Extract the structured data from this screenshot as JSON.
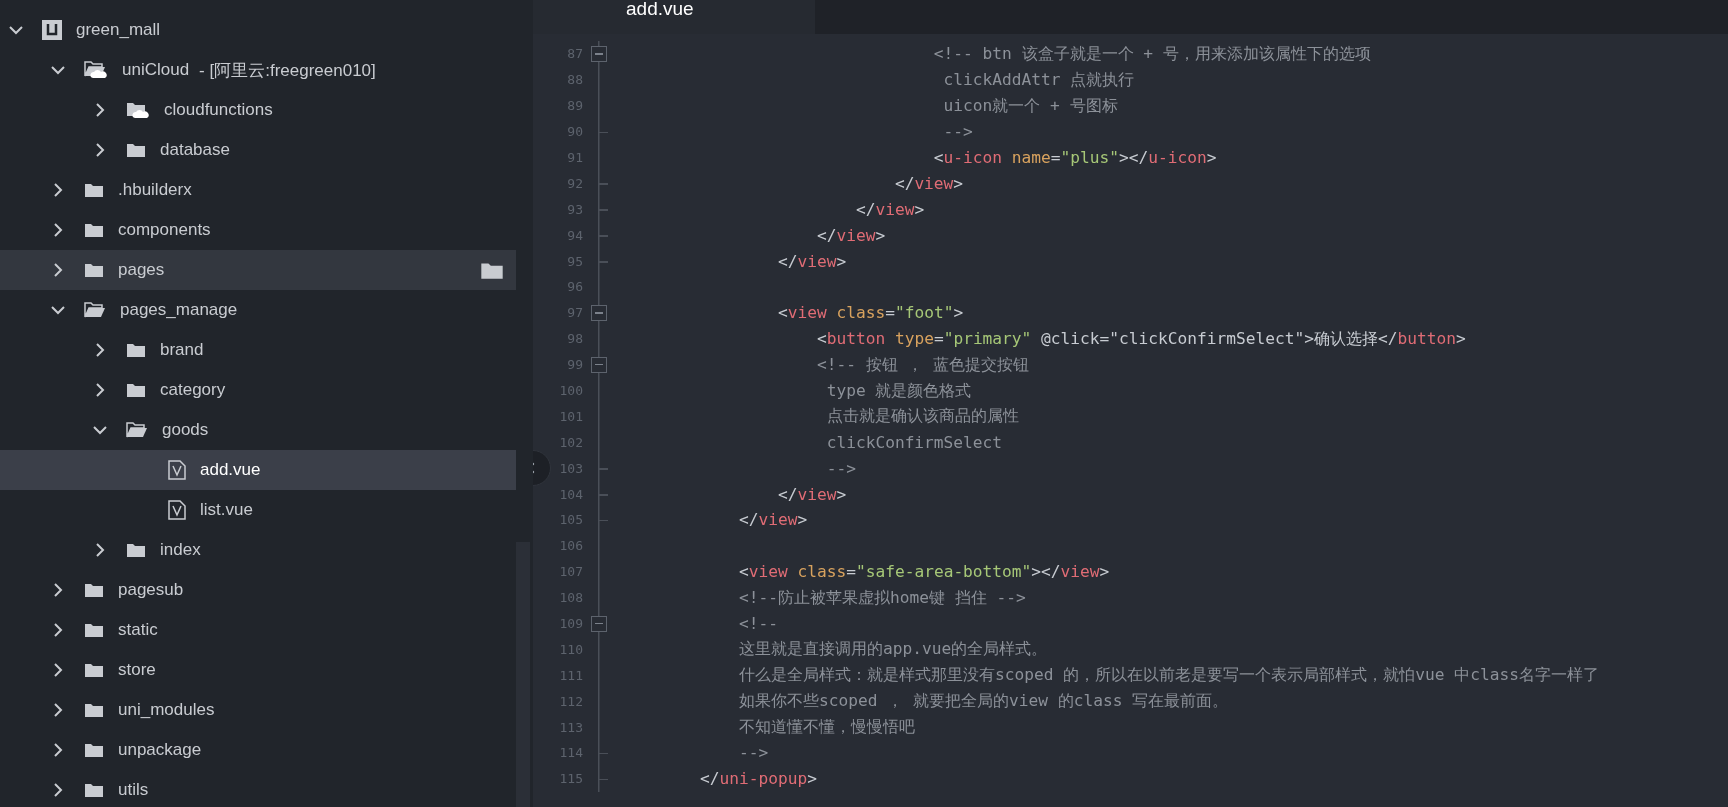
{
  "sidebar": {
    "tree": [
      {
        "label": "green_mall",
        "kind": "project",
        "expanded": true,
        "selected": false,
        "hovered": false,
        "children": [
          {
            "label": "uniCloud",
            "note": "- [阿里云:freegreen010]",
            "kind": "cloud",
            "expanded": true,
            "selected": false,
            "hovered": false,
            "children": [
              {
                "label": "cloudfunctions",
                "kind": "cloud",
                "expanded": false,
                "selected": false,
                "hovered": false
              },
              {
                "label": "database",
                "kind": "folder",
                "expanded": false,
                "selected": false,
                "hovered": false
              }
            ]
          },
          {
            "label": ".hbuilderx",
            "kind": "folder",
            "expanded": false,
            "selected": false,
            "hovered": false
          },
          {
            "label": "components",
            "kind": "folder",
            "expanded": false,
            "selected": false,
            "hovered": false
          },
          {
            "label": "pages",
            "kind": "folder",
            "expanded": false,
            "selected": false,
            "hovered": true
          },
          {
            "label": "pages_manage",
            "kind": "folder",
            "expanded": true,
            "selected": false,
            "hovered": false,
            "children": [
              {
                "label": "brand",
                "kind": "folder",
                "expanded": false,
                "selected": false,
                "hovered": false
              },
              {
                "label": "category",
                "kind": "folder",
                "expanded": false,
                "selected": false,
                "hovered": false
              },
              {
                "label": "goods",
                "kind": "folder",
                "expanded": true,
                "selected": false,
                "hovered": false,
                "children": [
                  {
                    "label": "add.vue",
                    "kind": "file",
                    "selected": true,
                    "hovered": false
                  },
                  {
                    "label": "list.vue",
                    "kind": "file",
                    "selected": false,
                    "hovered": false
                  }
                ]
              },
              {
                "label": "index",
                "kind": "folder",
                "expanded": false,
                "selected": false,
                "hovered": false
              }
            ]
          },
          {
            "label": "pagesub",
            "kind": "folder",
            "expanded": false,
            "selected": false,
            "hovered": false
          },
          {
            "label": "static",
            "kind": "folder",
            "expanded": false,
            "selected": false,
            "hovered": false
          },
          {
            "label": "store",
            "kind": "folder",
            "expanded": false,
            "selected": false,
            "hovered": false
          },
          {
            "label": "uni_modules",
            "kind": "folder",
            "expanded": false,
            "selected": false,
            "hovered": false
          },
          {
            "label": "unpackage",
            "kind": "folder",
            "expanded": false,
            "selected": false,
            "hovered": false
          },
          {
            "label": "utils",
            "kind": "folder",
            "expanded": false,
            "selected": false,
            "hovered": false
          }
        ]
      }
    ]
  },
  "editor": {
    "tabs": [
      {
        "label": "add.vue",
        "selected": true
      }
    ],
    "lines": [
      {
        "number": "87",
        "kind": "opener",
        "tokens": [
          {
            "kind": "comment",
            "text": "                                <!-- btn 该盒子就是一个 + 号，用来添加该属性下的选项"
          }
        ]
      },
      {
        "number": "88",
        "kind": "plain",
        "tokens": [
          {
            "kind": "comment",
            "text": "                                 clickAddAttr 点就执行"
          }
        ]
      },
      {
        "number": "89",
        "kind": "plain",
        "tokens": [
          {
            "kind": "comment",
            "text": "                                 uicon就一个 + 号图标"
          }
        ]
      },
      {
        "number": "90",
        "kind": "closer",
        "tokens": [
          {
            "kind": "comment",
            "text": "                                 -->"
          }
        ]
      },
      {
        "number": "91",
        "kind": "plain",
        "tokens": [
          {
            "kind": "punct",
            "text": "                                <"
          },
          {
            "kind": "tag",
            "text": "u-icon"
          },
          {
            "kind": "attr",
            "text": " name"
          },
          {
            "kind": "punct",
            "text": "="
          },
          {
            "kind": "string",
            "text": "\"plus\""
          },
          {
            "kind": "punct",
            "text": "></"
          },
          {
            "kind": "tag",
            "text": "u-icon"
          },
          {
            "kind": "punct",
            "text": ">"
          }
        ]
      },
      {
        "number": "92",
        "kind": "closer",
        "tokens": [
          {
            "kind": "punct",
            "text": "                            </"
          },
          {
            "kind": "tag",
            "text": "view"
          },
          {
            "kind": "punct",
            "text": ">"
          }
        ]
      },
      {
        "number": "93",
        "kind": "closer",
        "tokens": [
          {
            "kind": "punct",
            "text": "                        </"
          },
          {
            "kind": "tag",
            "text": "view"
          },
          {
            "kind": "punct",
            "text": ">"
          }
        ]
      },
      {
        "number": "94",
        "kind": "closer",
        "tokens": [
          {
            "kind": "punct",
            "text": "                    </"
          },
          {
            "kind": "tag",
            "text": "view"
          },
          {
            "kind": "punct",
            "text": ">"
          }
        ]
      },
      {
        "number": "95",
        "kind": "closer",
        "tokens": [
          {
            "kind": "punct",
            "text": "                </"
          },
          {
            "kind": "tag",
            "text": "view"
          },
          {
            "kind": "punct",
            "text": ">"
          }
        ]
      },
      {
        "number": "96",
        "kind": "plain"
      },
      {
        "number": "97",
        "kind": "opener",
        "tokens": [
          {
            "kind": "punct",
            "text": "                <"
          },
          {
            "kind": "tag",
            "text": "view"
          },
          {
            "kind": "attr",
            "text": " class"
          },
          {
            "kind": "punct",
            "text": "="
          },
          {
            "kind": "string",
            "text": "\"foot\""
          },
          {
            "kind": "punct",
            "text": ">"
          }
        ]
      },
      {
        "number": "98",
        "kind": "plain",
        "tokens": [
          {
            "kind": "punct",
            "text": "                    <"
          },
          {
            "kind": "tag",
            "text": "button"
          },
          {
            "kind": "attr",
            "text": " type"
          },
          {
            "kind": "punct",
            "text": "="
          },
          {
            "kind": "string",
            "text": "\"primary\""
          },
          {
            "kind": "punct",
            "text": " @click=\"clickConfirmSelect\">确认选择</"
          },
          {
            "kind": "tag",
            "text": "button"
          },
          {
            "kind": "punct",
            "text": ">"
          }
        ]
      },
      {
        "number": "99",
        "kind": "opener",
        "tokens": [
          {
            "kind": "comment",
            "text": "                    <!-- 按钮 ， 蓝色提交按钮"
          }
        ]
      },
      {
        "number": "100",
        "kind": "plain",
        "tokens": [
          {
            "kind": "comment",
            "text": "                     type 就是颜色格式"
          }
        ]
      },
      {
        "number": "101",
        "kind": "plain",
        "tokens": [
          {
            "kind": "comment",
            "text": "                     点击就是确认该商品的属性"
          }
        ]
      },
      {
        "number": "102",
        "kind": "plain",
        "tokens": [
          {
            "kind": "comment",
            "text": "                     clickConfirmSelect"
          }
        ]
      },
      {
        "number": "103",
        "kind": "closer",
        "tokens": [
          {
            "kind": "comment",
            "text": "                     -->"
          }
        ]
      },
      {
        "number": "104",
        "kind": "closer",
        "tokens": [
          {
            "kind": "punct",
            "text": "                </"
          },
          {
            "kind": "tag",
            "text": "view"
          },
          {
            "kind": "punct",
            "text": ">"
          }
        ]
      },
      {
        "number": "105",
        "kind": "closer",
        "tokens": [
          {
            "kind": "punct",
            "text": "            </"
          },
          {
            "kind": "tag",
            "text": "view"
          },
          {
            "kind": "punct",
            "text": ">"
          }
        ]
      },
      {
        "number": "106",
        "kind": "plain"
      },
      {
        "number": "107",
        "kind": "plain",
        "tokens": [
          {
            "kind": "punct",
            "text": "            <"
          },
          {
            "kind": "tag",
            "text": "view"
          },
          {
            "kind": "attr",
            "text": " class"
          },
          {
            "kind": "punct",
            "text": "="
          },
          {
            "kind": "string",
            "text": "\"safe-area-bottom\""
          },
          {
            "kind": "punct",
            "text": "></"
          },
          {
            "kind": "tag",
            "text": "view"
          },
          {
            "kind": "punct",
            "text": ">"
          }
        ]
      },
      {
        "number": "108",
        "kind": "plain",
        "tokens": [
          {
            "kind": "comment",
            "text": "            <!--防止被苹果虚拟home键 挡住 -->"
          }
        ]
      },
      {
        "number": "109",
        "kind": "opener",
        "tokens": [
          {
            "kind": "comment",
            "text": "            <!--"
          }
        ]
      },
      {
        "number": "110",
        "kind": "plain",
        "tokens": [
          {
            "kind": "comment",
            "text": "            这里就是直接调用的app.vue的全局样式。"
          }
        ]
      },
      {
        "number": "111",
        "kind": "plain",
        "tokens": [
          {
            "kind": "comment",
            "text": "            什么是全局样式：就是样式那里没有scoped 的，所以在以前老是要写一个表示局部样式，就怕vue 中class名字一样了"
          }
        ]
      },
      {
        "number": "112",
        "kind": "plain",
        "tokens": [
          {
            "kind": "comment",
            "text": "            如果你不些scoped ， 就要把全局的view 的class 写在最前面。"
          }
        ]
      },
      {
        "number": "113",
        "kind": "plain",
        "tokens": [
          {
            "kind": "comment",
            "text": "            不知道懂不懂，慢慢悟吧"
          }
        ]
      },
      {
        "number": "114",
        "kind": "closer",
        "tokens": [
          {
            "kind": "comment",
            "text": "            -->"
          }
        ]
      },
      {
        "number": "115",
        "kind": "closer",
        "tokens": [
          {
            "kind": "punct",
            "text": "        </"
          },
          {
            "kind": "tag",
            "text": "uni-popup"
          },
          {
            "kind": "punct",
            "text": ">"
          }
        ]
      }
    ]
  }
}
